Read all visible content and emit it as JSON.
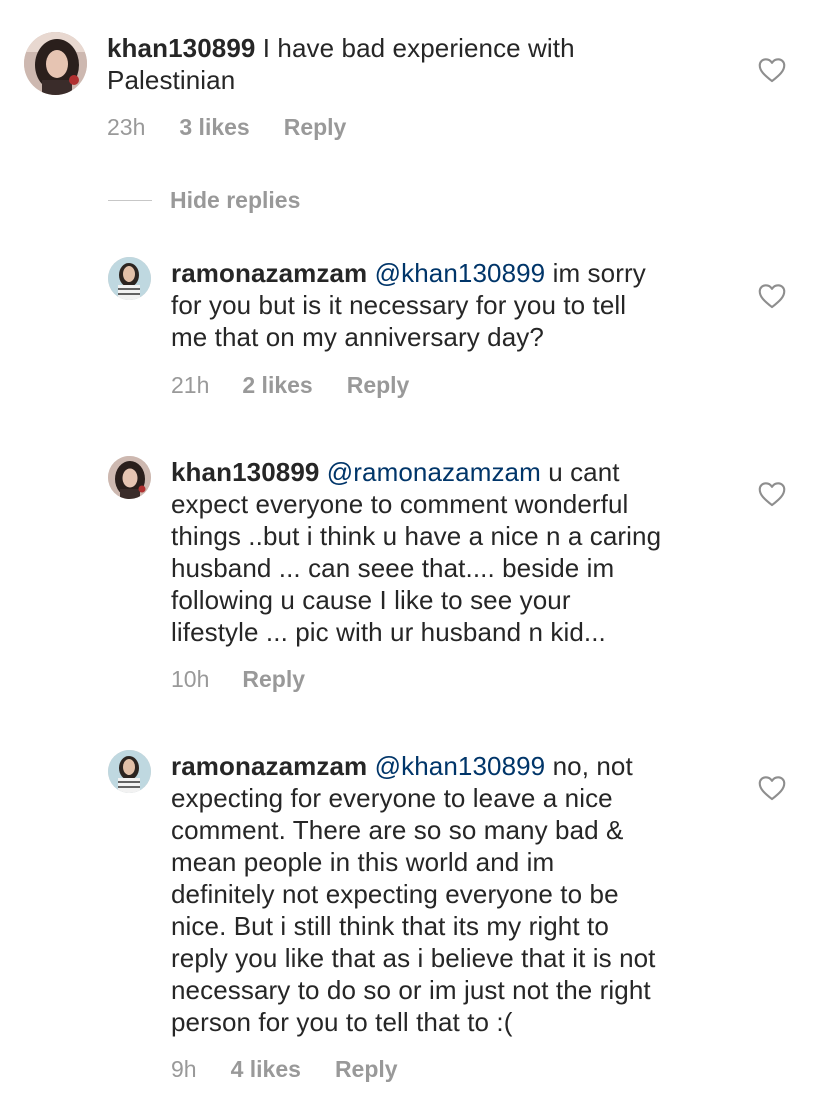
{
  "comments": [
    {
      "username": "khan130899",
      "mention": "",
      "text_lines": [
        "I have bad experience with",
        "Palestinian"
      ],
      "time": "23h",
      "likes": "3 likes",
      "reply": "Reply",
      "avatar": "khan130899-avatar"
    },
    {
      "username": "ramonazamzam",
      "mention": "@khan130899",
      "text_lines": [
        "im sorry",
        "for you but is it necessary for you to tell",
        "me that on my anniversary day?"
      ],
      "time": "21h",
      "likes": "2 likes",
      "reply": "Reply",
      "avatar": "ramonazamzam-avatar"
    },
    {
      "username": "khan130899",
      "mention": "@ramonazamzam",
      "text_lines": [
        "u cant",
        "expect everyone to comment wonderful",
        "things ..but i think u have a nice n a caring",
        "husband ... can seee that.... beside im",
        "following u cause I like to see your",
        "lifestyle ... pic with ur husband n  kid..."
      ],
      "time": "10h",
      "likes": "",
      "reply": "Reply",
      "avatar": "khan130899-avatar"
    },
    {
      "username": "ramonazamzam",
      "mention": "@khan130899",
      "text_lines": [
        "no, not",
        "expecting for everyone to leave a nice",
        "comment. There are so so many bad &",
        "mean people in this world and im",
        "definitely not expecting everyone to be",
        "nice. But i still think that its my right to",
        "reply you like that as i believe that it is not",
        "necessary to do so or im just not the right",
        "person for you to tell that to :("
      ],
      "time": "9h",
      "likes": "4 likes",
      "reply": "Reply",
      "avatar": "ramonazamzam-avatar"
    }
  ],
  "hide_replies": "Hide replies",
  "icons": {
    "like": "heart-outline-icon"
  },
  "colors": {
    "text": "#262626",
    "mention": "#003569",
    "meta": "#999999",
    "divider": "#c7c7c7"
  }
}
